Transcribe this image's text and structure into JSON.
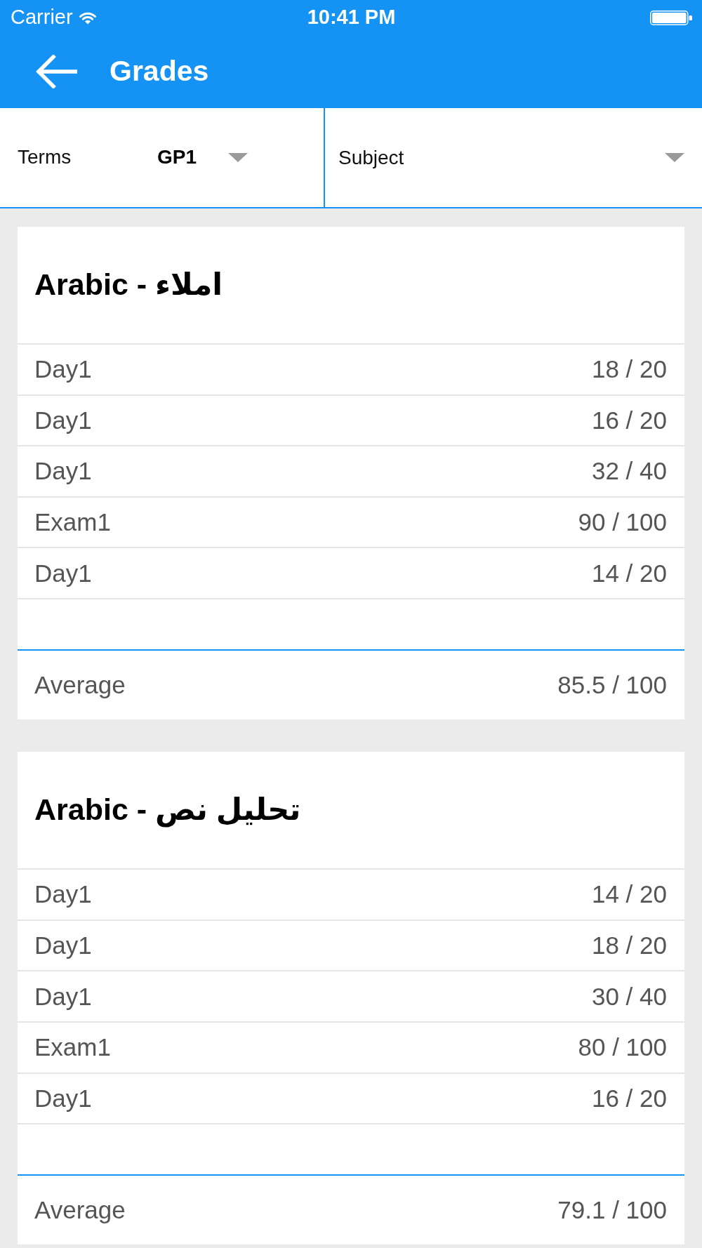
{
  "status_bar": {
    "carrier": "Carrier",
    "time": "10:41 PM"
  },
  "app_bar": {
    "title": "Grades"
  },
  "filters": [
    {
      "label": "Terms",
      "value": "GP1"
    },
    {
      "placeholder": "Subject"
    }
  ],
  "subjects": [
    {
      "title": "Arabic - املاء",
      "grades": [
        {
          "name": "Day1",
          "score": "18 / 20"
        },
        {
          "name": "Day1",
          "score": "16 / 20"
        },
        {
          "name": "Day1",
          "score": "32 / 40"
        },
        {
          "name": "Exam1",
          "score": "90 / 100"
        },
        {
          "name": "Day1",
          "score": "14 / 20"
        }
      ],
      "average_label": "Average",
      "average": "85.5 / 100"
    },
    {
      "title": "Arabic - تحليل نص",
      "grades": [
        {
          "name": "Day1",
          "score": "14 / 20"
        },
        {
          "name": "Day1",
          "score": "18 / 20"
        },
        {
          "name": "Day1",
          "score": "30 / 40"
        },
        {
          "name": "Exam1",
          "score": "80 / 100"
        },
        {
          "name": "Day1",
          "score": "16 / 20"
        }
      ],
      "average_label": "Average",
      "average": "79.1 / 100"
    }
  ]
}
